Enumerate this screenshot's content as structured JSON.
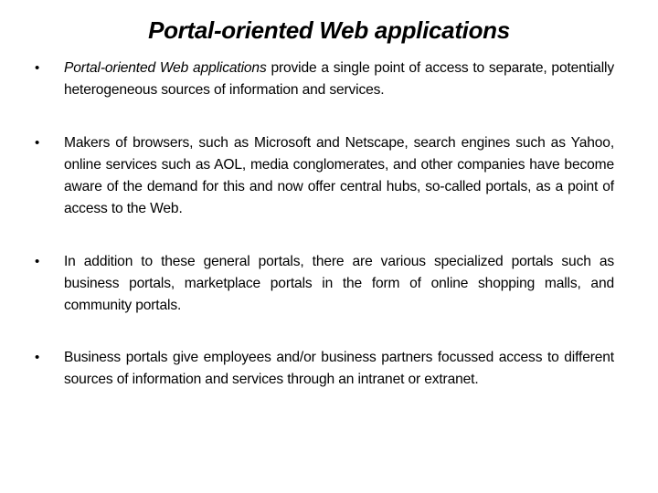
{
  "slide": {
    "title": "Portal-oriented Web applications",
    "bullet_glyph": "•",
    "bullets": [
      {
        "emphasis": "Portal-oriented Web applications",
        "text": " provide a single point of access to separate, potentially heterogeneous sources of information and services."
      },
      {
        "text": "Makers of browsers, such as Microsoft and Netscape, search engines such as Yahoo, online services such as AOL, media conglomerates, and other companies have become aware of the demand for this and now offer central hubs, so-called portals, as a point of access to the Web."
      },
      {
        "text": "In addition to these general portals, there are various specialized portals such as business portals, marketplace portals in the form of online shopping malls, and community portals."
      },
      {
        "text": "Business portals give employees and/or business partners focussed access to different sources of information and services through an intranet or extranet."
      }
    ]
  }
}
